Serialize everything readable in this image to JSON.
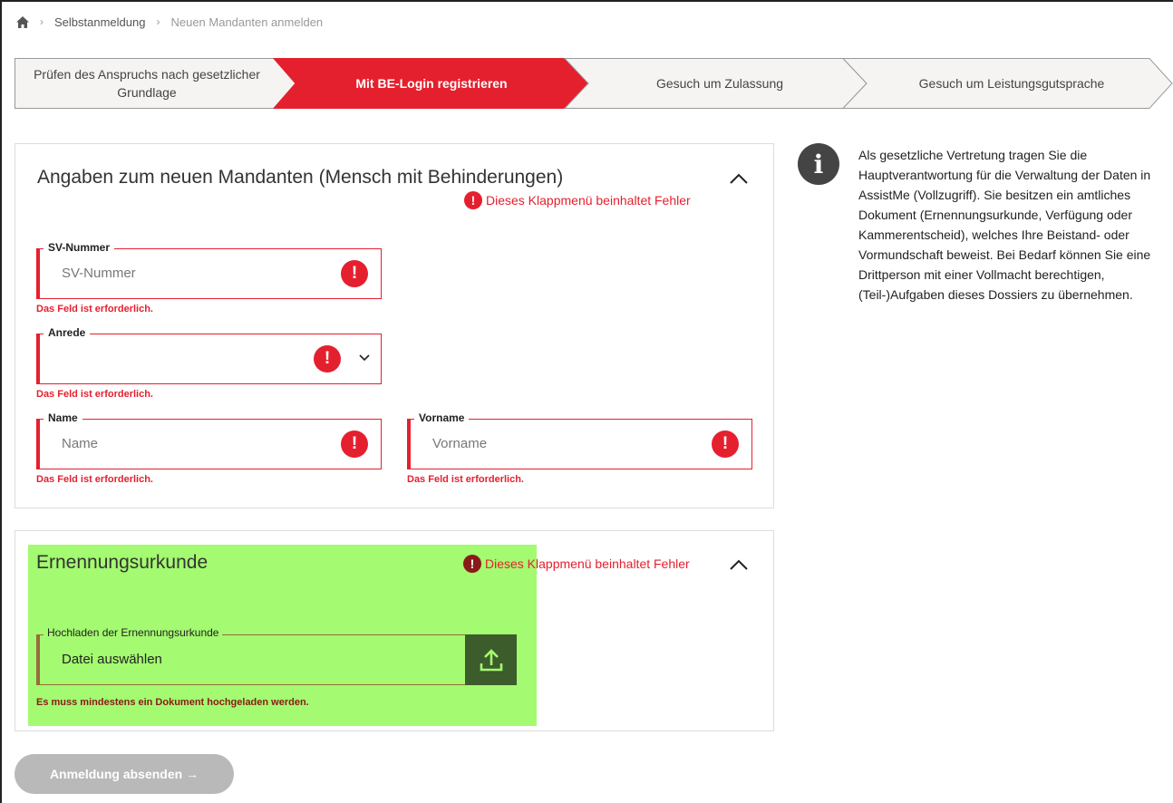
{
  "breadcrumb": {
    "home_icon": "home-icon",
    "items": [
      "Selbstanmeldung",
      "Neuen Mandanten anmelden"
    ]
  },
  "stepper": {
    "steps": [
      {
        "label": "Prüfen des Anspruchs nach gesetzlicher Grundlage",
        "state": "done"
      },
      {
        "label": "Mit BE-Login registrieren",
        "state": "active"
      },
      {
        "label": "Gesuch um Zulassung",
        "state": "pending"
      },
      {
        "label": "Gesuch um Leistungsgutsprache",
        "state": "pending"
      }
    ]
  },
  "panel_client": {
    "title": "Angaben zum neuen Mandanten (Mensch mit Behinderungen)",
    "error_text": "Dieses Klappmenü beinhaltet Fehler",
    "fields": {
      "sv_nummer": {
        "label": "SV-Nummer",
        "placeholder": "SV-Nummer",
        "error": "Das Feld ist erforderlich."
      },
      "anrede": {
        "label": "Anrede",
        "value": "",
        "error": "Das Feld ist erforderlich."
      },
      "name": {
        "label": "Name",
        "placeholder": "Name",
        "error": "Das Feld ist erforderlich."
      },
      "vorname": {
        "label": "Vorname",
        "placeholder": "Vorname",
        "error": "Das Feld ist erforderlich."
      }
    }
  },
  "panel_document": {
    "title": "Ernennungsurkunde",
    "error_text": "Dieses Klappmenü beinhaltet Fehler",
    "upload": {
      "label": "Hochladen der Ernennungsurkunde",
      "value": "Datei auswählen",
      "error": "Es muss mindestens ein Dokument hochgeladen werden."
    }
  },
  "info": {
    "text": "Als gesetzliche Vertretung tragen Sie die Hauptverantwortung für die Verwaltung der Daten in AssistMe (Vollzugriff). Sie besitzen ein amtliches Dokument (Ernennungsurkunde, Verfügung oder Kammerentscheid), welches Ihre Beistand- oder Vormundschaft beweist. Bei Bedarf können Sie eine Drittperson mit einer Vollmacht berechtigen, (Teil-)Aufgaben dieses Dossiers zu übernehmen."
  },
  "submit": {
    "label": "Anmeldung absenden →"
  },
  "colors": {
    "accent_red": "#e5202e",
    "highlight_green": "#a4fa70",
    "upload_button": "#3c5c2c",
    "disabled_button": "#b9b9b9"
  }
}
